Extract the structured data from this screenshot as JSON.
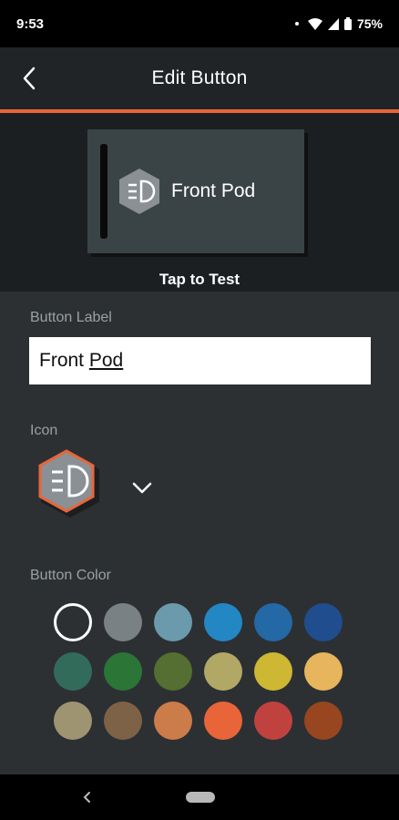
{
  "status": {
    "time": "9:53",
    "battery": "75%"
  },
  "app_bar": {
    "title": "Edit Button",
    "accent_color": "#e8653a"
  },
  "preview": {
    "button_label": "Front Pod",
    "tap_label": "Tap to Test"
  },
  "form": {
    "label_heading": "Button Label",
    "label_value_prefix": "Front ",
    "label_value_word": "Pod",
    "icon_heading": "Icon",
    "color_heading": "Button Color"
  },
  "icons": {
    "selected": "light-pod-icon",
    "dropdown": "chevron-down-icon"
  },
  "colors": {
    "selected_index": 0,
    "swatches": [
      "#2c3033",
      "#7a8185",
      "#6b9aad",
      "#2387c4",
      "#2468a5",
      "#1f4d8e",
      "#336b5a",
      "#2b7536",
      "#556e31",
      "#b2a866",
      "#cdb733",
      "#e6b55c",
      "#9f9471",
      "#7d6247",
      "#cb7c49",
      "#e8653a",
      "#c0423e",
      "#98461f"
    ]
  }
}
